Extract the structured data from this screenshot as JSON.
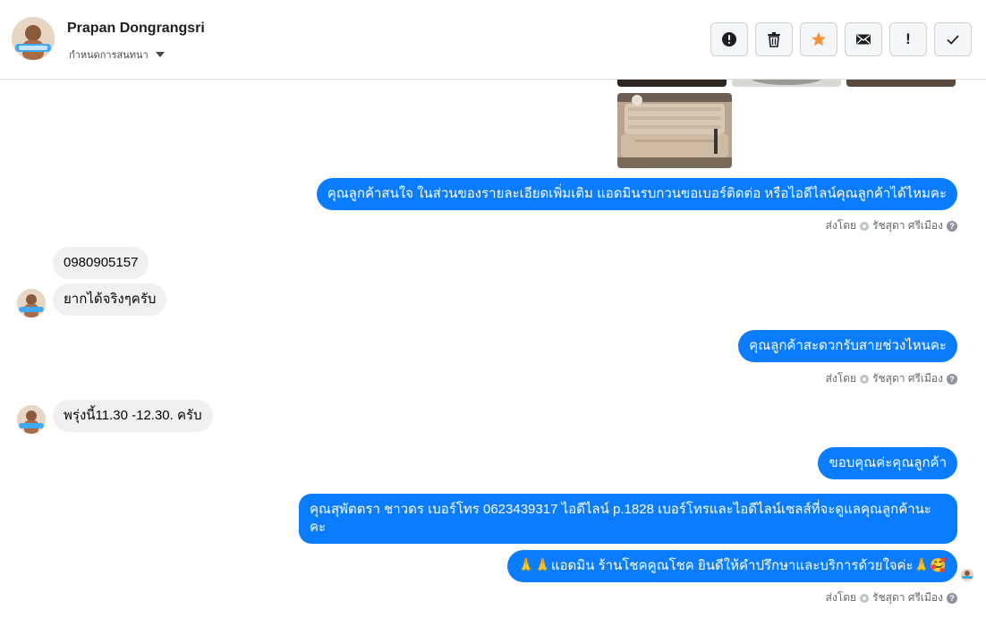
{
  "header": {
    "contact_name": "Prapan Dongrangsri",
    "assign_label": "กำหนดการสนทนา"
  },
  "toolbar": {
    "buttons": [
      {
        "name": "spam-button",
        "icon": "alert-circle-icon"
      },
      {
        "name": "delete-button",
        "icon": "trash-icon"
      },
      {
        "name": "star-button",
        "icon": "star-icon",
        "color": "#f7923b"
      },
      {
        "name": "mark-unread-button",
        "icon": "envelope-icon"
      },
      {
        "name": "follow-up-button",
        "icon": "exclamation-icon",
        "text": "!"
      },
      {
        "name": "done-button",
        "icon": "check-icon"
      }
    ]
  },
  "messages": {
    "m1": "คุณลูกค้าสนใจ ในส่วนของรายละเอียดเพิ่มเติม แอดมินรบกวนขอเบอร์ติดต่อ หรือไอดีไลน์คุณลูกค้าได้ไหมคะ",
    "m2": "0980905157",
    "m3": "ยากได้จริงๆครับ",
    "m4": "คุณลูกค้าสะดวกรับสายช่วงไหนคะ",
    "m5": "พรุ่งนี้11.30 -12.30. ครับ",
    "m6": "ขอบคุณค่ะคุณลูกค้า",
    "m7": "คุณสุพัตตรา   ชาวดร      เบอร์โทร 0623439317  ไอดีไลน์ p.1828   เบอร์โทรและไอดีไลน์เซลส์ที่จะดูแลคุณลูกค้านะคะ",
    "m8": "🙏🙏แอดมิน ร้านโชคคูณโชค ยินดีให้คำปรึกษาและบริการด้วยใจค่ะ🙏🥰"
  },
  "sent_by": {
    "prefix": "ส่งโดย",
    "agent": "รัชสุดา ศรีเมือง",
    "help": "?"
  },
  "colors": {
    "outgoing_bubble": "#0a7cff",
    "incoming_bubble": "#f0f0f0"
  }
}
